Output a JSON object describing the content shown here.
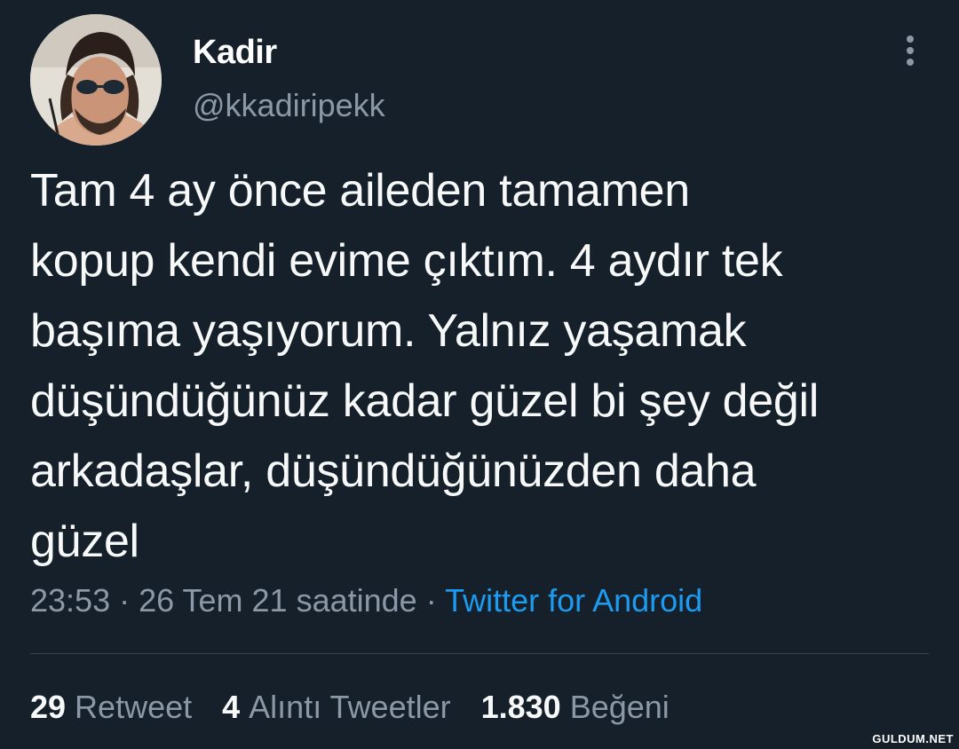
{
  "author": {
    "display_name": "Kadir",
    "handle": "@kkadiripekk",
    "avatar_icon": "profile-photo"
  },
  "tweet": {
    "text": "Tam 4 ay önce aileden tamamen\nkopup kendi evime çıktım. 4 aydır tek\nbaşıma yaşıyorum. Yalnız yaşamak\ndüşündüğünüz kadar güzel bi şey değil\narkadaşlar, düşündüğünüzden daha\ngüzel",
    "time": "23:53",
    "separator": "·",
    "date": "26 Tem 21 saatinde",
    "source": "Twitter for Android"
  },
  "stats": {
    "retweets_count": "29",
    "retweets_label": "Retweet",
    "quotes_count": "4",
    "quotes_label": "Alıntı Tweetler",
    "likes_count": "1.830",
    "likes_label": "Beğeni"
  },
  "watermark": "GULDUM.NET",
  "colors": {
    "background": "#15202b",
    "text": "#f7f9f9",
    "muted": "#8b98a5",
    "link": "#1d9bf0"
  }
}
